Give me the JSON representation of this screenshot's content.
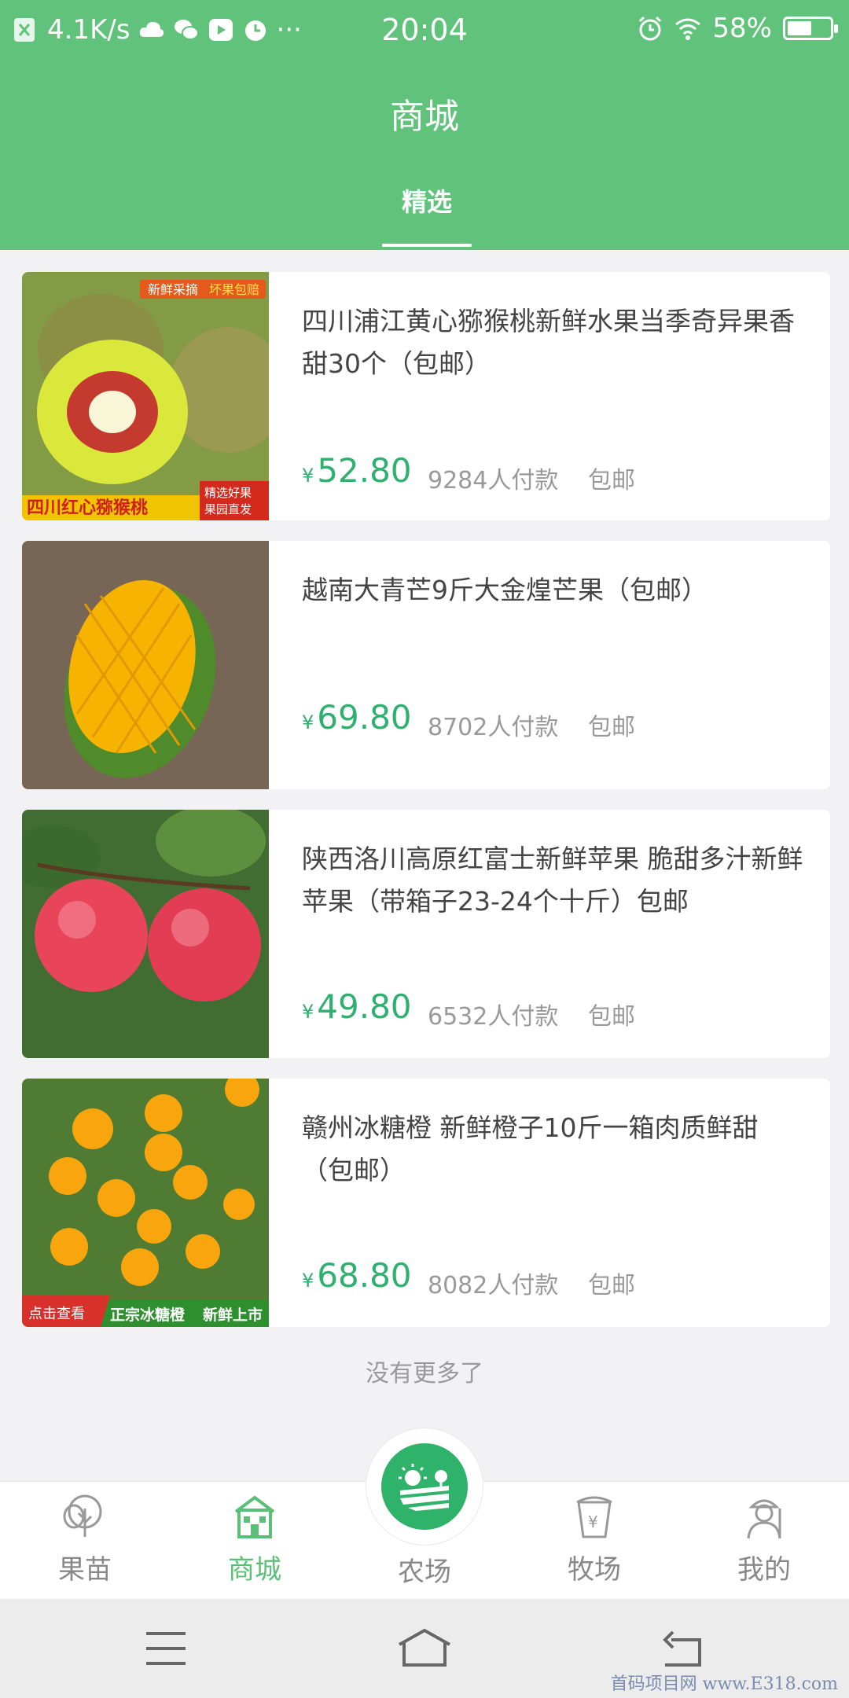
{
  "status_bar": {
    "speed": "4.1K/s",
    "time": "20:04",
    "battery": "58%",
    "battery_level": 0.58
  },
  "header": {
    "title": "商城",
    "tabs": [
      {
        "label": "精选",
        "active": true
      }
    ]
  },
  "products": [
    {
      "title": "四川浦江黄心猕猴桃新鲜水果当季奇异果香甜30个（包邮）",
      "currency": "¥",
      "price": "52.80",
      "sales": "9284人付款",
      "shipping": "包邮",
      "image_tags": [
        "新鲜采摘",
        "坏果包赔",
        "四川红心猕猴桃",
        "精选好果",
        "果园直发"
      ]
    },
    {
      "title": "越南大青芒9斤大金煌芒果（包邮）",
      "currency": "¥",
      "price": "69.80",
      "sales": "8702人付款",
      "shipping": "包邮",
      "image_tags": []
    },
    {
      "title": "陕西洛川高原红富士新鲜苹果 脆甜多汁新鲜苹果（带箱子23-24个十斤）包邮",
      "currency": "¥",
      "price": "49.80",
      "sales": "6532人付款",
      "shipping": "包邮",
      "image_tags": []
    },
    {
      "title": "赣州冰糖橙 新鲜橙子10斤一箱肉质鲜甜（包邮）",
      "currency": "¥",
      "price": "68.80",
      "sales": "8082人付款",
      "shipping": "包邮",
      "image_tags": [
        "点击查看",
        "正宗冰糖橙",
        "新鲜上市"
      ]
    }
  ],
  "list_footer": "没有更多了",
  "tabbar": {
    "items": [
      {
        "label": "果苗",
        "icon": "tree-icon"
      },
      {
        "label": "商城",
        "icon": "shop-icon",
        "active": true
      },
      {
        "label": "农场",
        "icon": "farm-icon"
      },
      {
        "label": "牧场",
        "icon": "bucket-icon"
      },
      {
        "label": "我的",
        "icon": "farmer-icon"
      }
    ]
  },
  "watermark": "首码项目网 www.E318.com",
  "colors": {
    "header": "#61c37b",
    "price": "#2eb06e",
    "active_tab": "#5cbf77",
    "farm_button": "#2fb26a"
  }
}
